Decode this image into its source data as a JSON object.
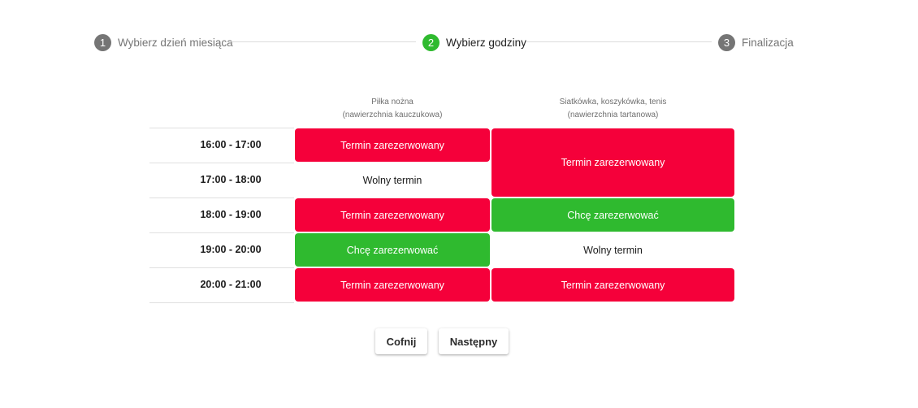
{
  "stepper": {
    "steps": [
      {
        "number": "1",
        "label": "Wybierz dzień miesiąca",
        "state": "inactive"
      },
      {
        "number": "2",
        "label": "Wybierz godziny",
        "state": "active"
      },
      {
        "number": "3",
        "label": "Finalizacja",
        "state": "inactive"
      }
    ],
    "colors": {
      "active": "#2fba2f",
      "inactive": "#757575",
      "active_text": "#202020",
      "inactive_text": "#757575"
    }
  },
  "table": {
    "columns": [
      {
        "name": "Piłka nożna",
        "subtitle": "(nawierzchnia kauczukowa)"
      },
      {
        "name": "Siatkówka, koszykówka, tenis",
        "subtitle": "(nawierzchnia tartanowa)"
      }
    ],
    "time_slots": [
      "16:00 - 17:00",
      "17:00 - 18:00",
      "18:00 - 19:00",
      "19:00 - 20:00",
      "20:00 - 21:00"
    ],
    "cells": {
      "col1": [
        {
          "label": "Termin zarezerwowany",
          "status": "reserved"
        },
        {
          "label": "Wolny termin",
          "status": "free"
        },
        {
          "label": "Termin zarezerwowany",
          "status": "reserved"
        },
        {
          "label": "Chcę zarezerwować",
          "status": "book"
        },
        {
          "label": "Termin zarezerwowany",
          "status": "reserved"
        }
      ],
      "col2": [
        {
          "label": "Termin zarezerwowany",
          "status": "reserved",
          "slots": "16:00 - 18:00"
        },
        {
          "label": "Chcę zarezerwować",
          "status": "book"
        },
        {
          "label": "Wolny termin",
          "status": "free"
        },
        {
          "label": "Termin zarezerwowany",
          "status": "reserved"
        }
      ]
    },
    "colors": {
      "reserved": "#f5003a",
      "book": "#2fba2f"
    }
  },
  "actions": {
    "back_label": "Cofnij",
    "next_label": "Następny"
  }
}
